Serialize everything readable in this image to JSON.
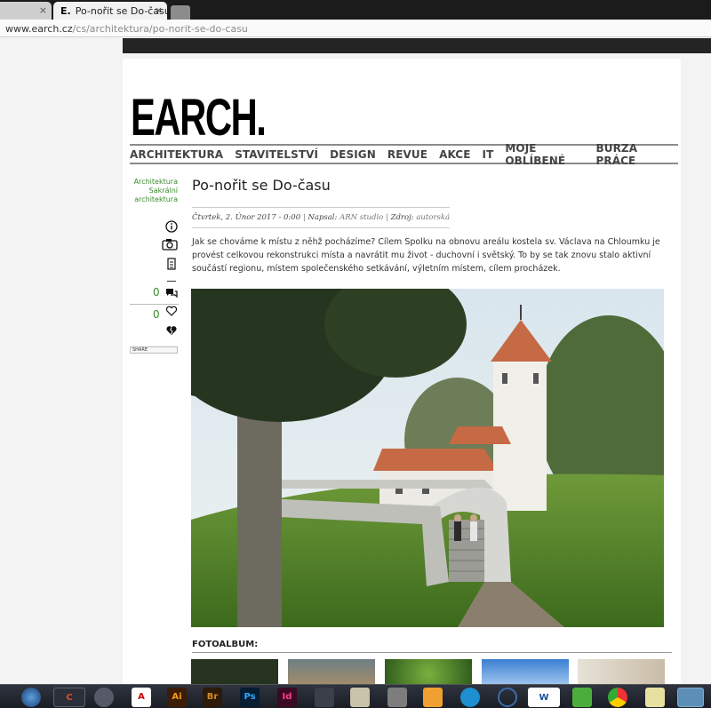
{
  "browser": {
    "tabs": [
      {
        "label": "",
        "close": "×"
      },
      {
        "label": "Po-nořit se Do-času | EAI",
        "favicon": "E.",
        "close": "×"
      }
    ],
    "url_host": "www.earch.cz",
    "url_path": "/cs/architektura/po-norit-se-do-casu"
  },
  "site": {
    "logo": "EARCH.",
    "nav": [
      "ARCHITEKTURA",
      "STAVITELSTVÍ",
      "DESIGN",
      "REVUE",
      "AKCE",
      "IT",
      "MOJE OBLÍBENÉ",
      "BURZA PRÁCE"
    ]
  },
  "sidebar": {
    "categories": [
      "Architektura",
      "Sakrální",
      "architektura"
    ],
    "comment_count": "0",
    "like_count": "0",
    "share_label": "SHARE"
  },
  "article": {
    "title": "Po-nořit se Do-času",
    "date": "Čtvrtek, 2. Únor 2017 - 0:00",
    "author_label": "Napsal:",
    "author": "ARN studio",
    "source_label": "Zdroj:",
    "source": "autorská zpráva",
    "lead": "Jak se chováme k místu z něhž pocházíme? Cílem Spolku na obnovu areálu kostela sv. Václava na Chloumku je provést celkovou rekonstrukci místa a navrátit mu život - duchovní i světský. To by se tak znovu stalo aktivní součástí regionu, místem společenského setkávání, výletním místem, cílem procházek.",
    "fotoalbum_label": "FOTOALBUM:"
  },
  "taskbar": {
    "icons": [
      "start-orb-icon",
      "ccleaner-icon",
      "media-icon",
      "acrobat-icon",
      "illustrator-icon",
      "bridge-icon",
      "photoshop-icon",
      "indesign-icon",
      "unknown-icon",
      "explorer-icon",
      "media-player-icon",
      "skype-icon",
      "search-icon",
      "word-icon",
      "utorrent-icon",
      "chrome-icon",
      "sticky-icon",
      "window-icon"
    ],
    "labels": {
      "ai": "Ai",
      "br": "Br",
      "ps": "Ps",
      "id": "Id",
      "w": "W"
    }
  }
}
